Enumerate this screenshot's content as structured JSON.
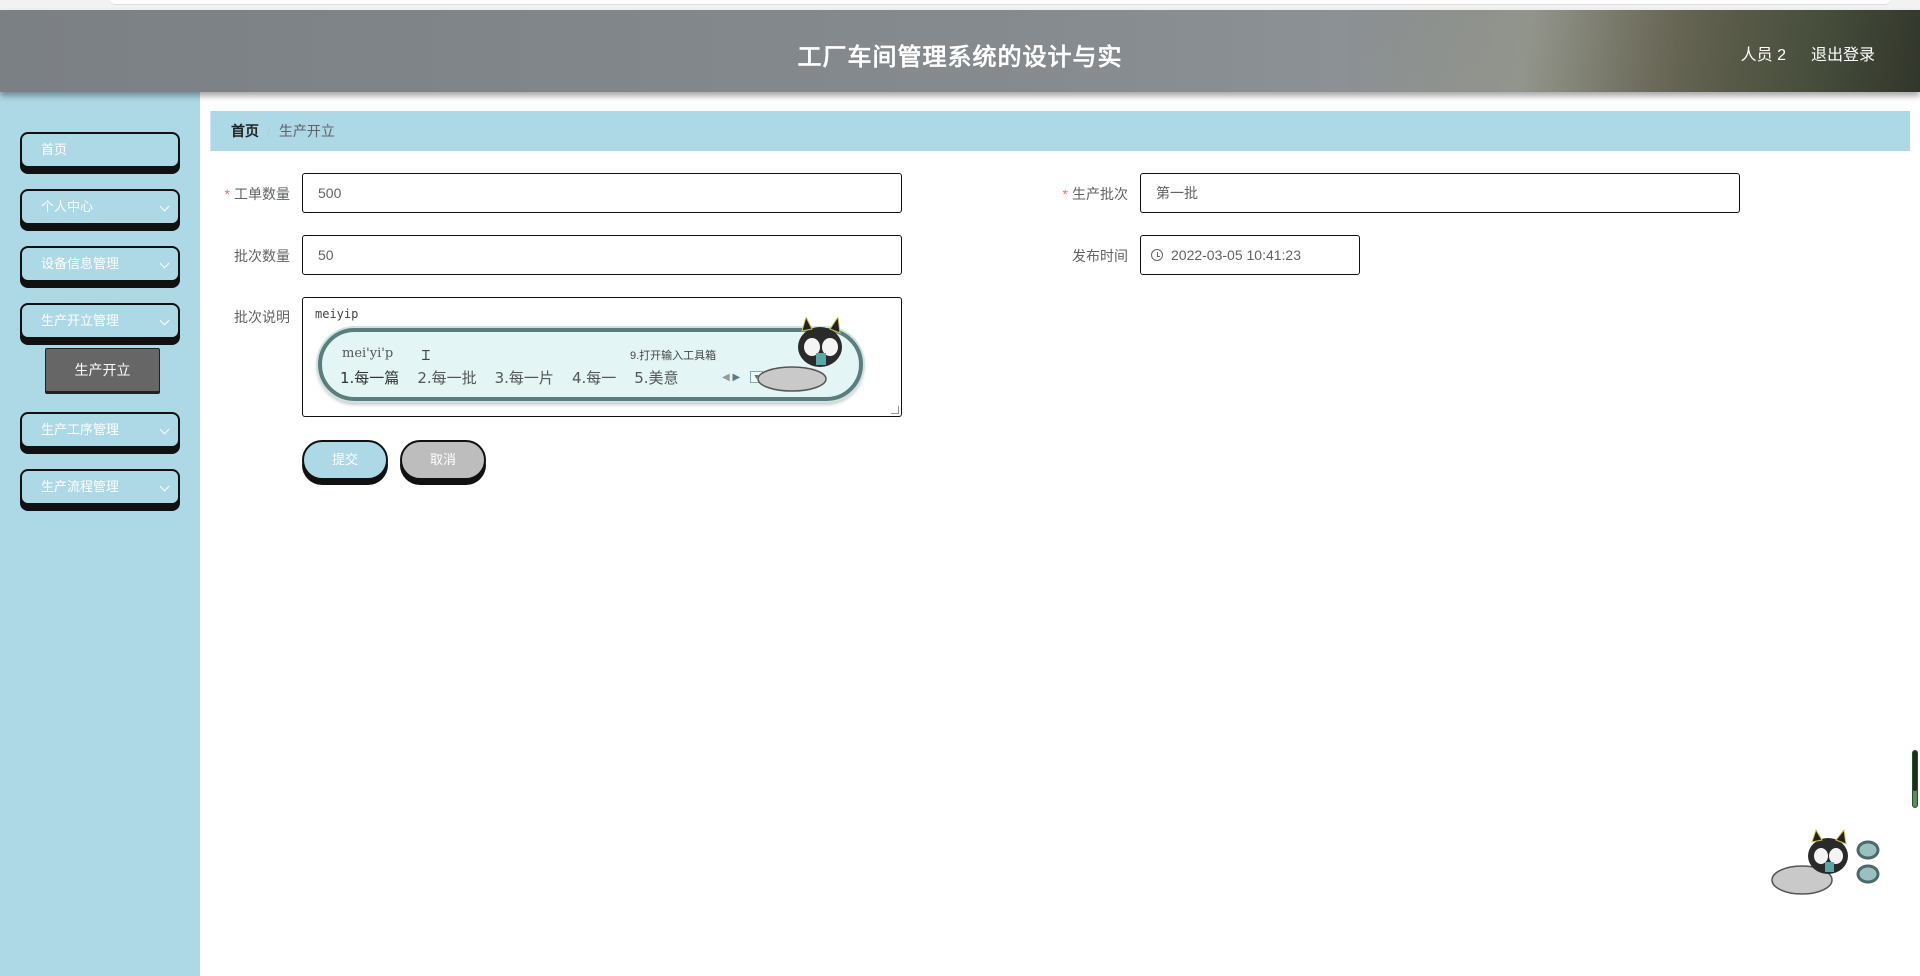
{
  "header": {
    "title": "工厂车间管理系统的设计与实",
    "user": "人员 2",
    "logout": "退出登录"
  },
  "sidebar": {
    "items": [
      {
        "label": "首页"
      },
      {
        "label": "个人中心"
      },
      {
        "label": "设备信息管理"
      },
      {
        "label": "生产开立管理"
      },
      {
        "label": "生产工序管理"
      },
      {
        "label": "生产流程管理"
      }
    ],
    "active_sub": "生产开立"
  },
  "breadcrumb": {
    "home": "首页",
    "separator": "/",
    "current": "生产开立"
  },
  "form": {
    "work_order_qty": {
      "label": "工单数量",
      "value": "500"
    },
    "batch": {
      "label": "生产批次",
      "value": "第一批"
    },
    "batch_qty": {
      "label": "批次数量",
      "value": "50"
    },
    "publish_time": {
      "label": "发布时间",
      "value": "2022-03-05 10:41:23"
    },
    "batch_note": {
      "label": "批次说明",
      "value": "meiyip"
    },
    "submit": "提交",
    "cancel": "取消"
  },
  "ime": {
    "pinyin": "mei'yi'p",
    "tool_hint": "9.打开输入工具箱",
    "candidates": [
      "1.每一篇",
      "2.每一批",
      "3.每一片",
      "4.每一",
      "5.美意"
    ]
  }
}
